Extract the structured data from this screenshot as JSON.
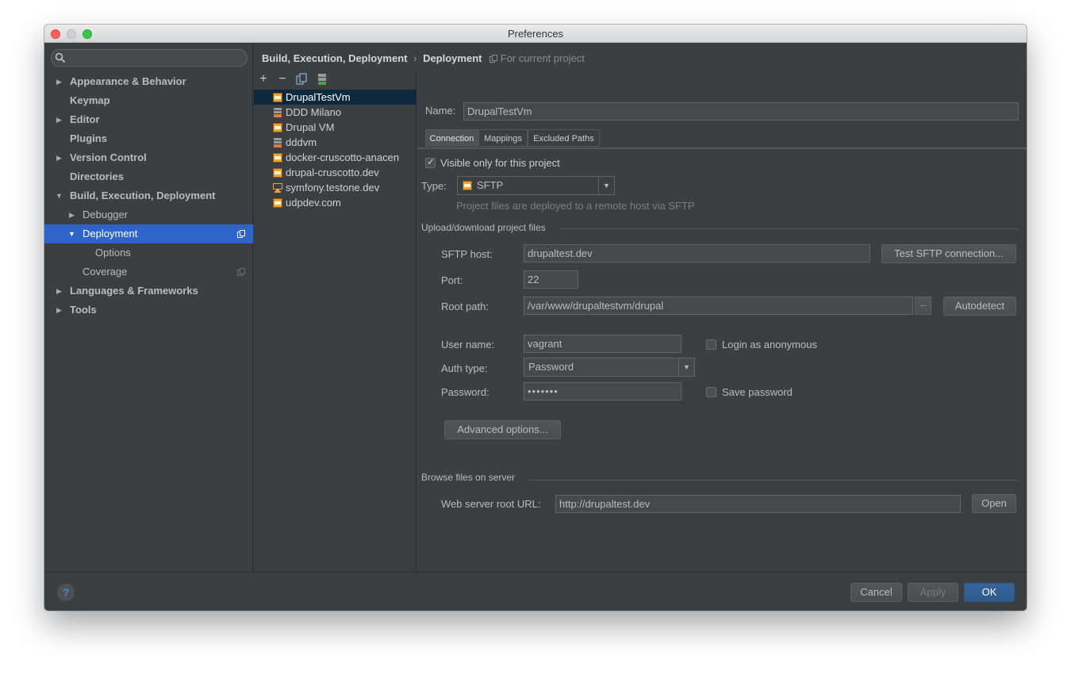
{
  "window": {
    "title": "Preferences"
  },
  "search": {
    "placeholder": ""
  },
  "sidebar": {
    "items": [
      {
        "label": "Appearance & Behavior",
        "arrow": "▶"
      },
      {
        "label": "Keymap",
        "arrow": ""
      },
      {
        "label": "Editor",
        "arrow": "▶"
      },
      {
        "label": "Plugins",
        "arrow": ""
      },
      {
        "label": "Version Control",
        "arrow": "▶"
      },
      {
        "label": "Directories",
        "arrow": ""
      },
      {
        "label": "Build, Execution, Deployment",
        "arrow": "▼"
      },
      {
        "label": "Debugger",
        "arrow": "▶"
      },
      {
        "label": "Deployment",
        "arrow": "▼"
      },
      {
        "label": "Options",
        "arrow": ""
      },
      {
        "label": "Coverage",
        "arrow": ""
      },
      {
        "label": "Languages & Frameworks",
        "arrow": "▶"
      },
      {
        "label": "Tools",
        "arrow": "▶"
      }
    ]
  },
  "breadcrumb": {
    "items": [
      "Build, Execution, Deployment",
      "Deployment"
    ],
    "separator": "›",
    "scope": "For current project"
  },
  "toolbar": {
    "add": "+",
    "remove": "−"
  },
  "servers": [
    "DrupalTestVm",
    "DDD Milano",
    "Drupal VM",
    "dddvm",
    "docker-cruscotto-anacen",
    "drupal-cruscotto.dev",
    "symfony.testone.dev",
    "udpdev.com"
  ],
  "form": {
    "name_label": "Name:",
    "name_value": "DrupalTestVm",
    "tabs": [
      "Connection",
      "Mappings",
      "Excluded Paths"
    ],
    "visible_only_label": "Visible only for this project",
    "visible_only_checked": true,
    "type_label": "Type:",
    "type_value": "SFTP",
    "type_hint": "Project files are deployed to a remote host via SFTP",
    "upload_section": "Upload/download project files",
    "sftp_host_label": "SFTP host:",
    "sftp_host_value": "drupaltest.dev",
    "test_button": "Test SFTP connection...",
    "port_label": "Port:",
    "port_value": "22",
    "root_path_label": "Root path:",
    "root_path_value": "/var/www/drupaltestvm/drupal",
    "browse_button": "...",
    "autodetect_button": "Autodetect",
    "user_name_label": "User name:",
    "user_name_value": "vagrant",
    "login_anonymous_label": "Login as anonymous",
    "auth_type_label": "Auth type:",
    "auth_type_value": "Password",
    "password_label": "Password:",
    "password_value": "•••••••",
    "save_password_label": "Save password",
    "advanced_button": "Advanced options...",
    "browse_section": "Browse files on server",
    "web_root_label": "Web server root URL:",
    "web_root_value": "http://drupaltest.dev",
    "open_button": "Open"
  },
  "footer": {
    "help": "?",
    "cancel": "Cancel",
    "apply": "Apply",
    "ok": "OK"
  },
  "colors": {
    "accent": "#2f65ca",
    "background": "#3c3f41",
    "selected_server": "#0d293e"
  }
}
